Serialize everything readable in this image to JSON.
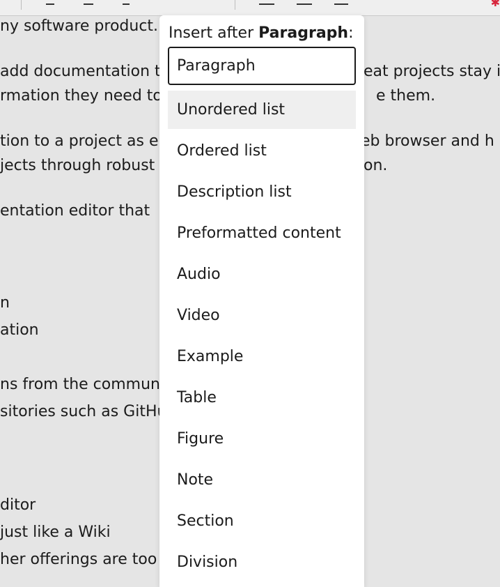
{
  "document": {
    "lines": [
      "ny software product.",
      "add documentation t",
      "rmation they need to",
      "tion to a project as e",
      "jects through robust",
      "entation editor that",
      "n",
      "ation",
      "ns from the communi",
      "sitories such as GitHu",
      "ditor",
      "just like a Wiki",
      "her offerings are too"
    ],
    "right_fragments": [
      "eat projects stay i",
      "e them.",
      "eb browser and h",
      "on."
    ]
  },
  "popup": {
    "title_prefix": "Insert after",
    "title_block": "Paragraph",
    "title_suffix": ":",
    "items": [
      {
        "label": "Paragraph",
        "state": "focused"
      },
      {
        "label": "Unordered list",
        "state": "hover"
      },
      {
        "label": "Ordered list"
      },
      {
        "label": "Description list"
      },
      {
        "label": "Preformatted content"
      },
      {
        "label": "Audio"
      },
      {
        "label": "Video"
      },
      {
        "label": "Example"
      },
      {
        "label": "Table"
      },
      {
        "label": "Figure"
      },
      {
        "label": "Note"
      },
      {
        "label": "Section"
      },
      {
        "label": "Division"
      }
    ]
  }
}
